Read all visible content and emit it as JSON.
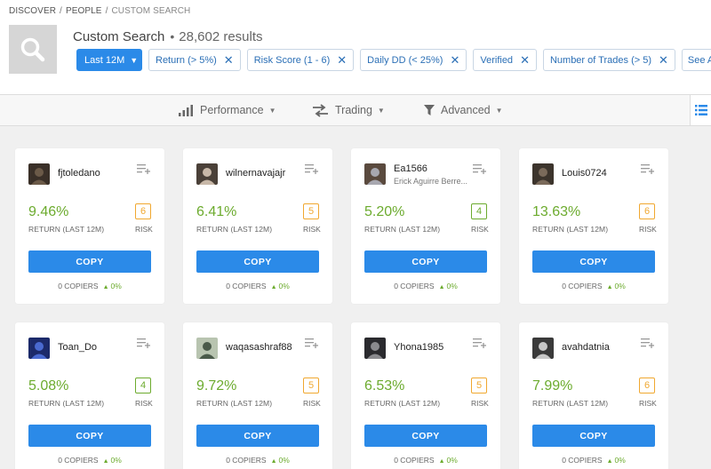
{
  "breadcrumb": [
    "DISCOVER",
    "PEOPLE",
    "CUSTOM SEARCH"
  ],
  "header": {
    "title": "Custom Search",
    "results": "28,602 results"
  },
  "filters": {
    "period": "Last 12M",
    "chips": [
      "Return (> 5%)",
      "Risk Score (1 - 6)",
      "Daily DD (< 25%)",
      "Verified",
      "Number of Trades (> 5)"
    ],
    "see_all": "See All"
  },
  "toolbar": {
    "performance": "Performance",
    "trading": "Trading",
    "advanced": "Advanced"
  },
  "labels": {
    "return": "RETURN (LAST 12M)",
    "risk": "RISK",
    "copy": "COPY",
    "copiers_suffix": "COPIERS"
  },
  "colors": {
    "accent": "#2b8ae8",
    "positive": "#6cab2e",
    "risk_green": "#6cab2e",
    "risk_orange": "#f0a830"
  },
  "cards": [
    {
      "username": "fjtoledano",
      "subname": "",
      "return": "9.46%",
      "risk": "6",
      "risk_color": "orange",
      "copiers": "0 COPIERS",
      "copiers_change": "0%",
      "avatar_colors": [
        "#3a3028",
        "#6b5a48"
      ]
    },
    {
      "username": "wilnernavajajr",
      "subname": "",
      "return": "6.41%",
      "risk": "5",
      "risk_color": "orange",
      "copiers": "0 COPIERS",
      "copiers_change": "0%",
      "avatar_colors": [
        "#4a4038",
        "#c8b8a8"
      ]
    },
    {
      "username": "Ea1566",
      "subname": "Erick Aguirre Berre...",
      "return": "5.20%",
      "risk": "4",
      "risk_color": "green",
      "copiers": "0 COPIERS",
      "copiers_change": "0%",
      "avatar_colors": [
        "#5a4a3e",
        "#a8a8b0"
      ]
    },
    {
      "username": "Louis0724",
      "subname": "",
      "return": "13.63%",
      "risk": "6",
      "risk_color": "orange",
      "copiers": "0 COPIERS",
      "copiers_change": "0%",
      "avatar_colors": [
        "#3c342c",
        "#7a6a5a"
      ]
    },
    {
      "username": "Toan_Do",
      "subname": "",
      "return": "5.08%",
      "risk": "4",
      "risk_color": "green",
      "copiers": "0 COPIERS",
      "copiers_change": "0%",
      "avatar_colors": [
        "#1c2a6a",
        "#4a6ad0"
      ]
    },
    {
      "username": "waqasashraf88",
      "subname": "",
      "return": "9.72%",
      "risk": "5",
      "risk_color": "orange",
      "copiers": "0 COPIERS",
      "copiers_change": "0%",
      "avatar_colors": [
        "#b8c4b0",
        "#4a5a4a"
      ]
    },
    {
      "username": "Yhona1985",
      "subname": "",
      "return": "6.53%",
      "risk": "5",
      "risk_color": "orange",
      "copiers": "0 COPIERS",
      "copiers_change": "0%",
      "avatar_colors": [
        "#2a2a2e",
        "#8a8a8e"
      ]
    },
    {
      "username": "avahdatnia",
      "subname": "",
      "return": "7.99%",
      "risk": "6",
      "risk_color": "orange",
      "copiers": "0 COPIERS",
      "copiers_change": "0%",
      "avatar_colors": [
        "#3a3a3a",
        "#c8c8c8"
      ]
    }
  ]
}
